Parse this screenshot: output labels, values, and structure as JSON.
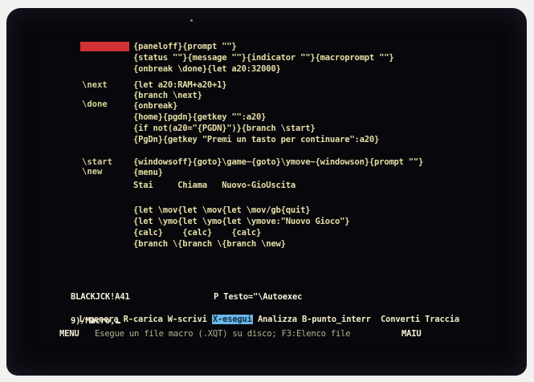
{
  "macro_labels": {
    "autoexec": "\\Autoexec",
    "next": "\\next",
    "done": "\\done",
    "start": "\\start",
    "new": "\\new"
  },
  "code_lines": [
    "{paneloff}{prompt \"\"}",
    "{status \"\"}{message \"\"}{indicator \"\"}{macroprompt \"\"}",
    "{onbreak \\done}{let a20:32000}",
    "{let a20:RAM+a20+1}",
    "{branch \\next}",
    "{onbreak}",
    "{home}{pgdn}{getkey \"\":a20}",
    "{if not(a20=\"{PGDN}\")}{branch \\start}",
    "{PgDn}{getkey \"Premi un tasto per continuare\":a20}",
    "{windowsoff}{goto}\\game~{goto}\\ymove~{windowson}{prompt \"\"}",
    "{menu}",
    "Stai     Chiama   Nuovo-GioUscita",
    "{let \\mov{let \\mov{let \\mov/gb{quit}",
    "{let \\ymo{let \\ymo{let \\ymove:\"Nuovo Gioco\"}",
    "{calc}    {calc}    {calc}",
    "{branch \\{branch \\{branch \\new}"
  ],
  "status_bar": {
    "cell_ref": "BLACKJCK!A41",
    "cell_content": "P Testo=\"\\Autoexec"
  },
  "menu": {
    "item_genera": "L-genera",
    "item_carica": "R-carica",
    "item_scrivi": "W-scrivi",
    "item_esegui": "X-esegui",
    "item_analizza": "Analizza",
    "item_punto_interr": "B-punto_interr",
    "item_converti": "Converti",
    "item_traccia": "Traccia",
    "path_line": "9)/Macro,"
  },
  "help_bar": {
    "mode": "MENU",
    "description": "Esegue un file macro (.XQT) su disco; F3:Elenco file",
    "status": "MAIU"
  },
  "colors": {
    "screen_bg": "#08080c",
    "text": "#e6dfa6",
    "highlight_red": "#d23234",
    "highlight_cyan": "#6ab6e6"
  }
}
